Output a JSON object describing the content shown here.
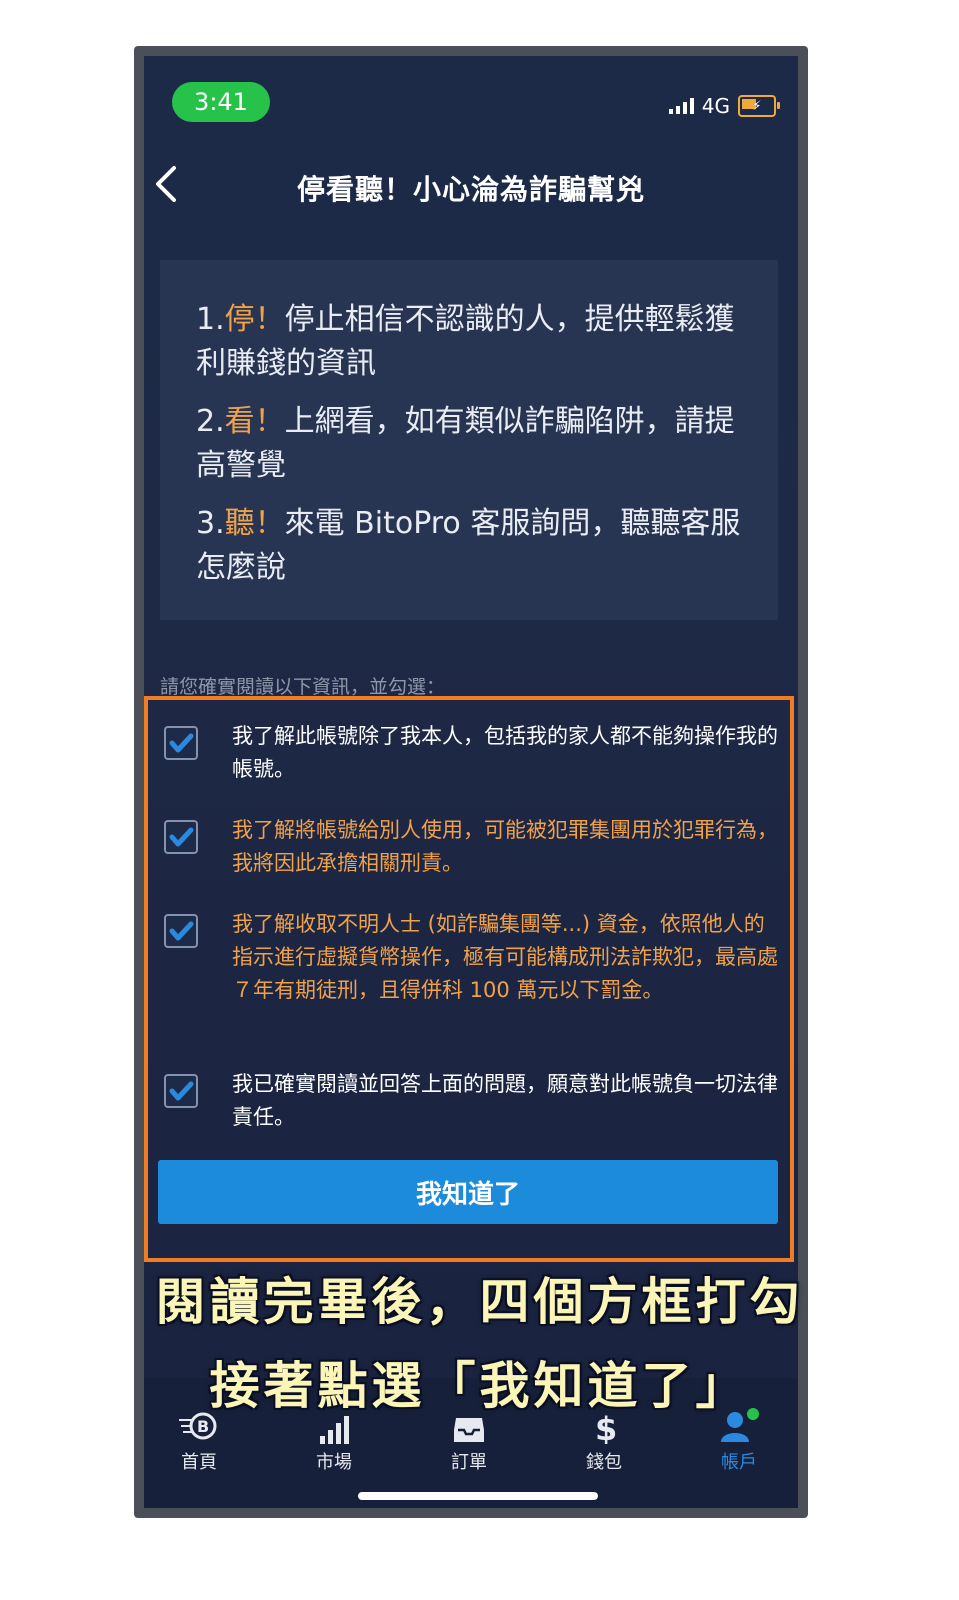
{
  "status_bar": {
    "time": "3:41",
    "network": "4G"
  },
  "header": {
    "title": "停看聽！小心淪為詐騙幫兇"
  },
  "warnings": [
    {
      "number": "1.",
      "keyword": "停！",
      "text": "停止相信不認識的人，提供輕鬆獲利賺錢的資訊"
    },
    {
      "number": "2.",
      "keyword": "看！",
      "text": "上網看，如有類似詐騙陷阱，請提高警覺"
    },
    {
      "number": "3.",
      "keyword": "聽！",
      "text": "來電 BitoPro 客服詢問，聽聽客服怎麼說"
    }
  ],
  "instruction": "請您確實閱讀以下資訊，並勾選：",
  "checklist": [
    {
      "text": "我了解此帳號除了我本人，包括我的家人都不能夠操作我的帳號。",
      "checked": true,
      "highlight": false
    },
    {
      "text": "我了解將帳號給別人使用，可能被犯罪集團用於犯罪行為，我將因此承擔相關刑責。",
      "checked": true,
      "highlight": true
    },
    {
      "text": "我了解收取不明人士 (如詐騙集團等...) 資金，依照他人的指示進行虛擬貨幣操作，極有可能構成刑法詐欺犯，最高處７年有期徒刑，且得併科 100 萬元以下罰金。",
      "checked": true,
      "highlight": true
    },
    {
      "text": "我已確實閱讀並回答上面的問題，願意對此帳號負一切法律責任。",
      "checked": true,
      "highlight": false
    }
  ],
  "confirm_button": "我知道了",
  "tabs": [
    {
      "label": "首頁",
      "icon": "bitopro-logo-icon",
      "active": false
    },
    {
      "label": "市場",
      "icon": "market-bars-icon",
      "active": false
    },
    {
      "label": "訂單",
      "icon": "orders-tray-icon",
      "active": false
    },
    {
      "label": "錢包",
      "icon": "wallet-dollar-icon",
      "active": false
    },
    {
      "label": "帳戶",
      "icon": "account-user-icon",
      "active": true
    }
  ],
  "caption": {
    "line1": "閱讀完畢後，四個方框打勾",
    "line2": "接著點選「我知道了」"
  },
  "colors": {
    "accent_orange": "#f07c24",
    "button_blue": "#1d8bdc",
    "highlight_text": "#f0a24a",
    "status_green": "#26c24a"
  }
}
